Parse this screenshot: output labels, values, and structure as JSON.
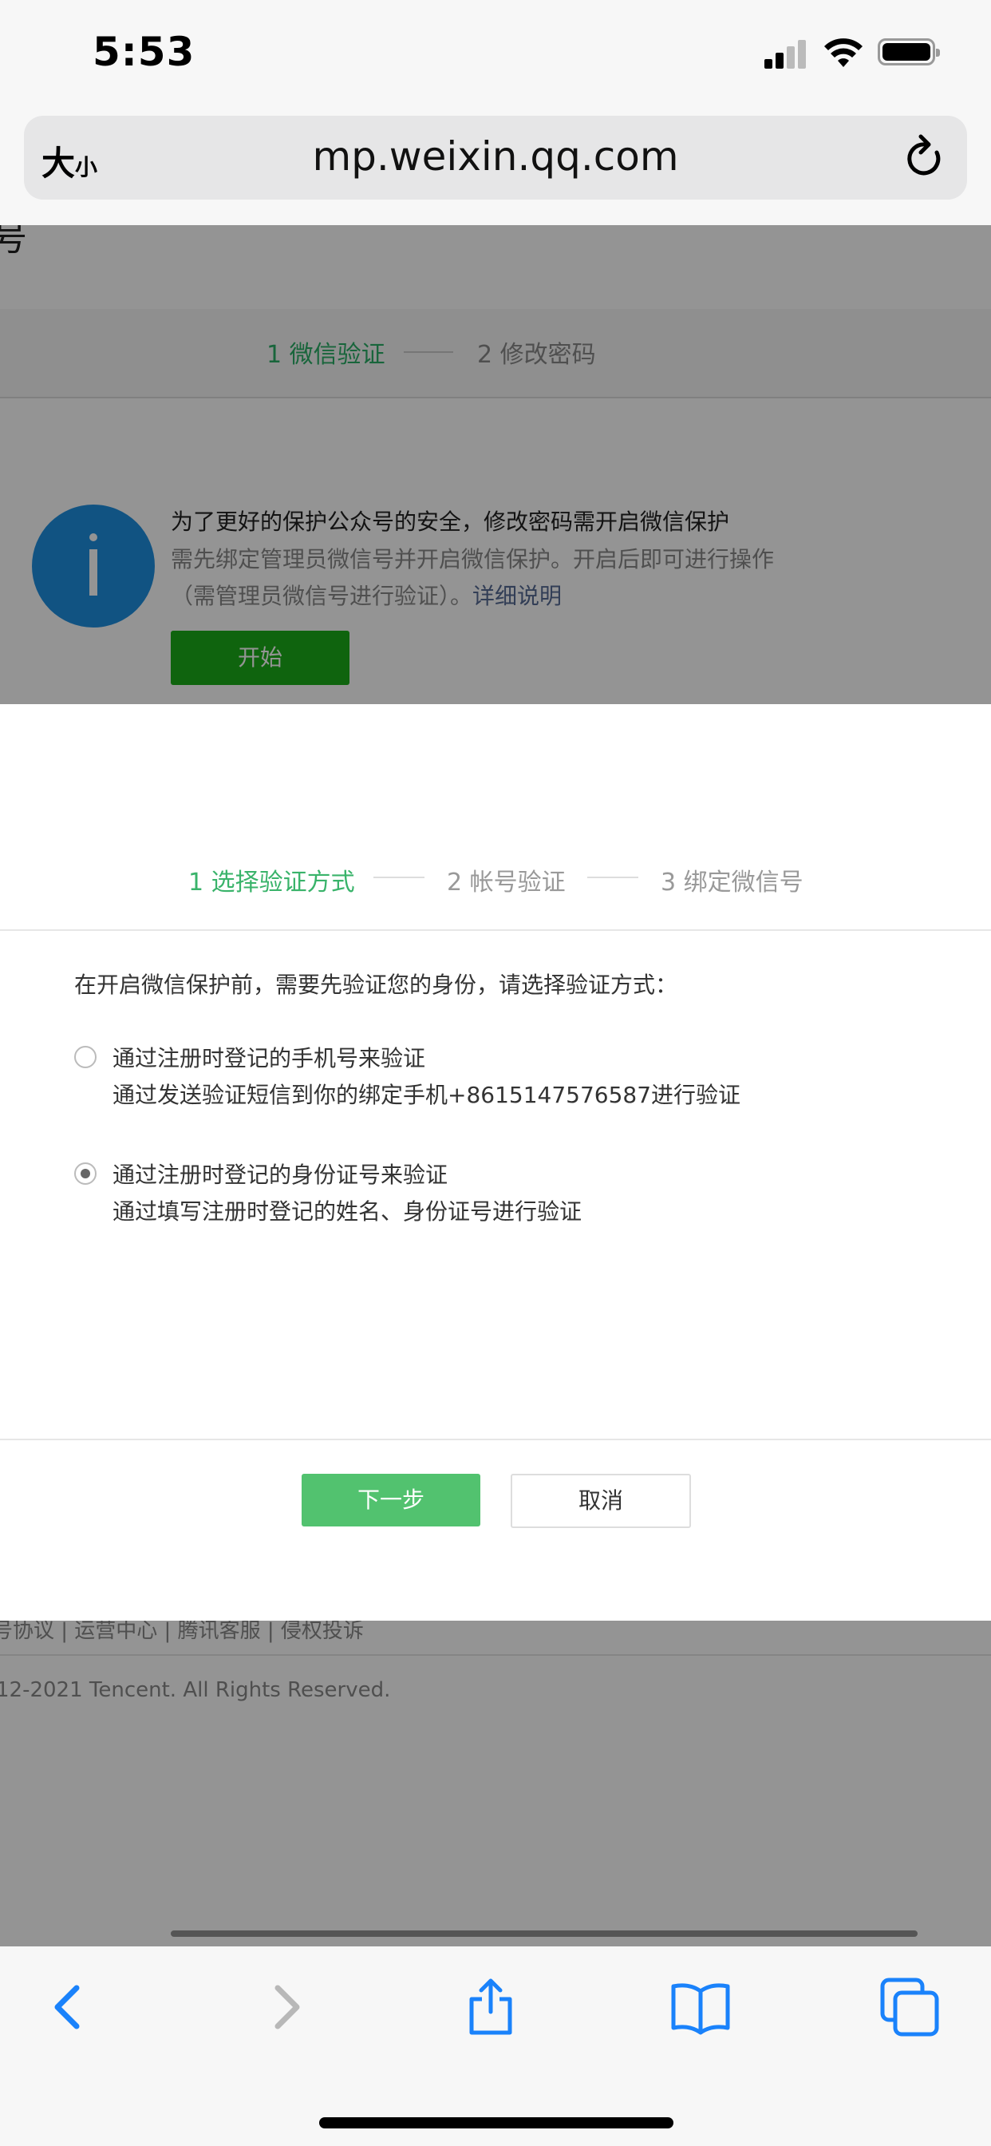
{
  "status_bar": {
    "time": "5:53"
  },
  "browser": {
    "text_size_big": "大",
    "text_size_small": "小",
    "url": "mp.weixin.qq.com"
  },
  "page": {
    "header_stub": "号",
    "steps": [
      {
        "label": "1 微信验证"
      },
      {
        "label": "2 修改密码"
      }
    ],
    "info": {
      "title": "为了更好的保护公众号的安全，修改密码需开启微信保护",
      "line1": "需先绑定管理员微信号并开启微信保护。开启后即可进行操作",
      "line2": "（需管理员微信号进行验证）。",
      "link": "详细说明",
      "start_button": "开始"
    },
    "footer_links": "号协议 | 运营中心 | 腾讯客服 | 侵权投诉",
    "copyright": "12-2021 Tencent. All Rights Reserved."
  },
  "modal": {
    "steps": [
      {
        "label": "1 选择验证方式"
      },
      {
        "label": "2 帐号验证"
      },
      {
        "label": "3 绑定微信号"
      }
    ],
    "prompt": "在开启微信保护前，需要先验证您的身份，请选择验证方式：",
    "options": [
      {
        "title": "通过注册时登记的手机号来验证",
        "desc": "通过发送验证短信到你的绑定手机+8615147576587进行验证",
        "selected": false
      },
      {
        "title": "通过注册时登记的身份证号来验证",
        "desc": "通过填写注册时登记的姓名、身份证号进行验证",
        "selected": true
      }
    ],
    "next_button": "下一步",
    "cancel_button": "取消"
  },
  "toolbar": {
    "icons": [
      "back-icon",
      "forward-icon",
      "share-icon",
      "bookmarks-icon",
      "tabs-icon"
    ]
  },
  "colors": {
    "accent_green": "#39b36a",
    "button_green": "#52c26f",
    "link_blue": "#576b95",
    "safari_blue": "#1a82fb"
  }
}
